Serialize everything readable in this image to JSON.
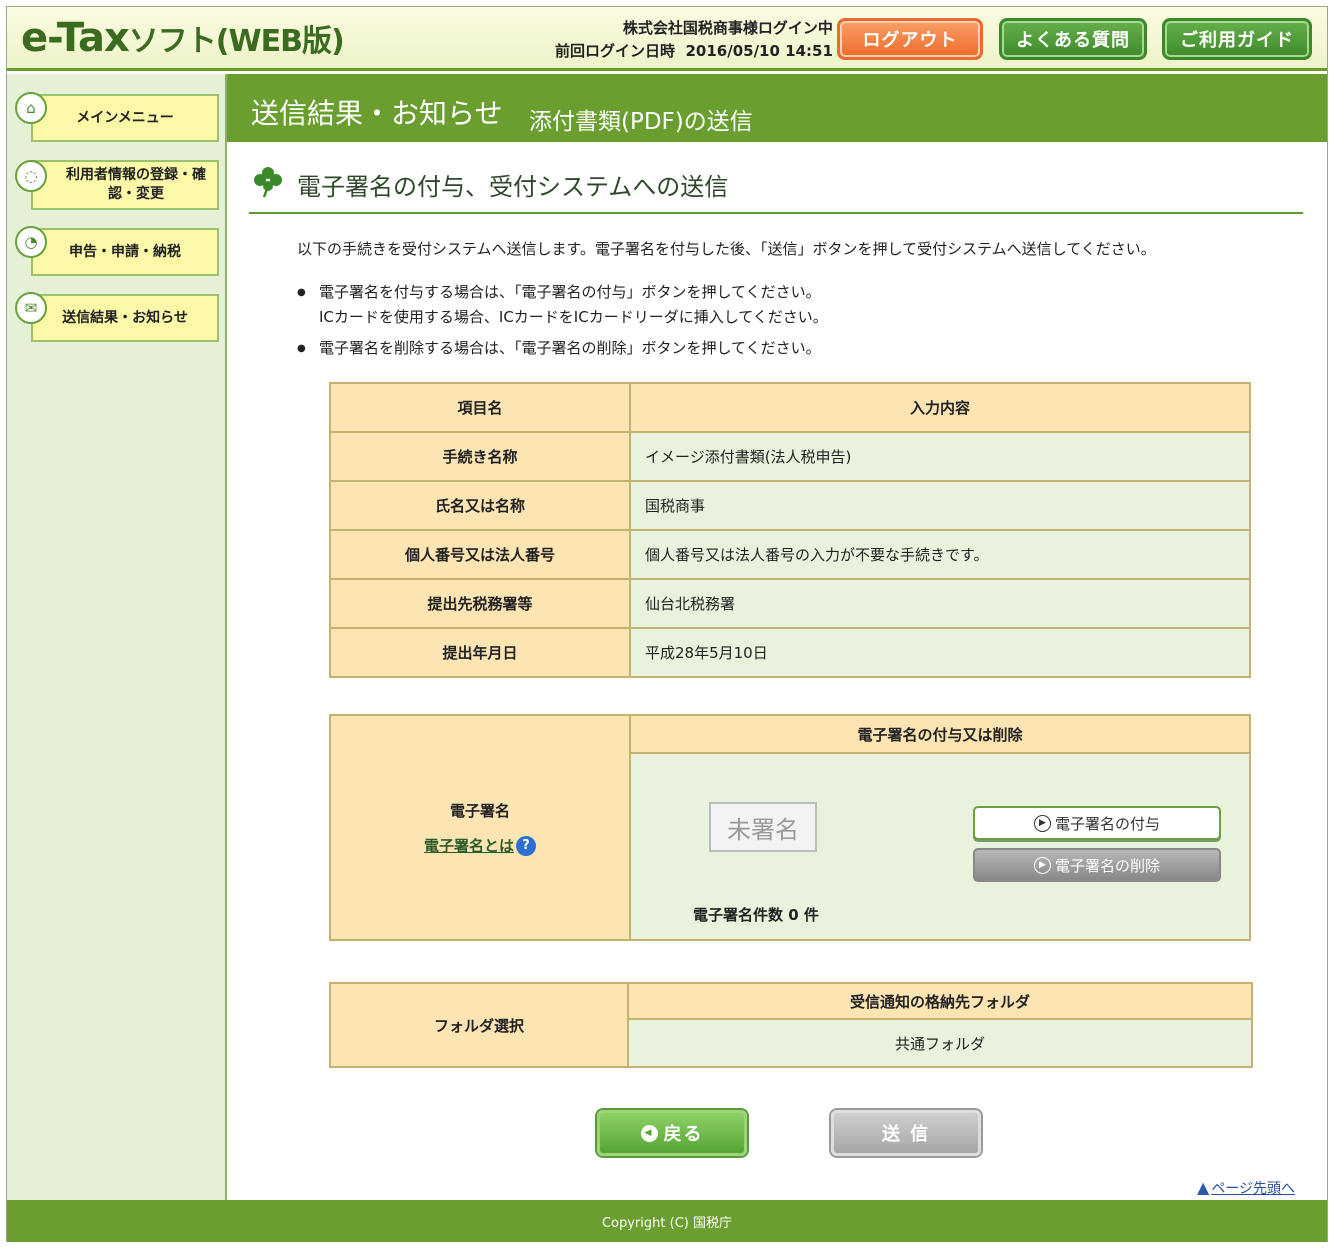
{
  "header": {
    "logo_main": "e-Tax",
    "logo_soft": "ソフト(WEB版)",
    "login_user": "株式会社国税商事様ログイン中",
    "last_login_label": "前回ログイン日時",
    "last_login_value": "2016/05/10 14:51",
    "logout_label": "ログアウト",
    "faq_label": "よくある質問",
    "guide_label": "ご利用ガイド"
  },
  "sidebar": {
    "items": [
      {
        "label": "メインメニュー",
        "icon": "home-icon"
      },
      {
        "label": "利用者情報の登録・確認・変更",
        "icon": "user-info-icon"
      },
      {
        "label": "申告・申請・納税",
        "icon": "declaration-icon"
      },
      {
        "label": "送信結果・お知らせ",
        "icon": "mail-icon"
      }
    ]
  },
  "titlebar": {
    "main": "送信結果・お知らせ",
    "sub": "添付書類(PDF)の送信"
  },
  "section_title": "電子署名の付与、受付システムへの送信",
  "intro": "以下の手続きを受付システムへ送信します。電子署名を付与した後、「送信」ボタンを押して受付システムへ送信してください。",
  "notes": [
    {
      "line1": "電子署名を付与する場合は、「電子署名の付与」ボタンを押してください。",
      "line2": "ICカードを使用する場合、ICカードをICカードリーダに挿入してください。"
    },
    {
      "line1": "電子署名を削除する場合は、「電子署名の削除」ボタンを押してください。",
      "line2": ""
    }
  ],
  "info_table": {
    "header": {
      "item": "項目名",
      "value": "入力内容"
    },
    "rows": [
      {
        "label": "手続き名称",
        "value": "イメージ添付書類(法人税申告)"
      },
      {
        "label": "氏名又は名称",
        "value": "国税商事"
      },
      {
        "label": "個人番号又は法人番号",
        "value": "個人番号又は法人番号の入力が不要な手続きです。"
      },
      {
        "label": "提出先税務署等",
        "value": "仙台北税務署"
      },
      {
        "label": "提出年月日",
        "value": "平成28年5月10日"
      }
    ]
  },
  "signature": {
    "label": "電子署名",
    "link": "電子署名とは",
    "header": "電子署名の付与又は削除",
    "status": "未署名",
    "sign_button": "電子署名の付与",
    "delete_button": "電子署名の削除",
    "count_text": "電子署名件数 0 件"
  },
  "folder": {
    "label": "フォルダ選択",
    "header": "受信通知の格納先フォルダ",
    "value": "共通フォルダ"
  },
  "buttons": {
    "back": "戻る",
    "send": "送 信"
  },
  "page_top": "ページ先頭へ",
  "footer": "Copyright (C) 国税庁"
}
